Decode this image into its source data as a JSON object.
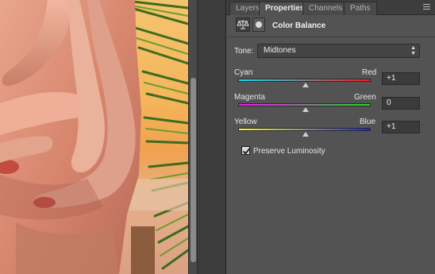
{
  "tabs": [
    {
      "label": "Layers",
      "active": false
    },
    {
      "label": "Properties",
      "active": true
    },
    {
      "label": "Channels",
      "active": false
    },
    {
      "label": "Paths",
      "active": false
    }
  ],
  "header": {
    "title": "Color Balance",
    "icons": [
      "balance-scale-icon",
      "layer-mask-icon"
    ]
  },
  "tone": {
    "label": "Tone:",
    "value": "Midtones"
  },
  "sliders": [
    {
      "left": "Cyan",
      "right": "Red",
      "value": "+1",
      "level": 0.505
    },
    {
      "left": "Magenta",
      "right": "Green",
      "value": "0",
      "level": 0.5
    },
    {
      "left": "Yellow",
      "right": "Blue",
      "value": "+1",
      "level": 0.505
    }
  ],
  "preserve": {
    "label": "Preserve Luminosity",
    "checked": true
  },
  "colors": {
    "panel_bg": "#535353",
    "tab_bar_bg": "#3d3d3d",
    "field_bg": "#3b3b3b"
  }
}
